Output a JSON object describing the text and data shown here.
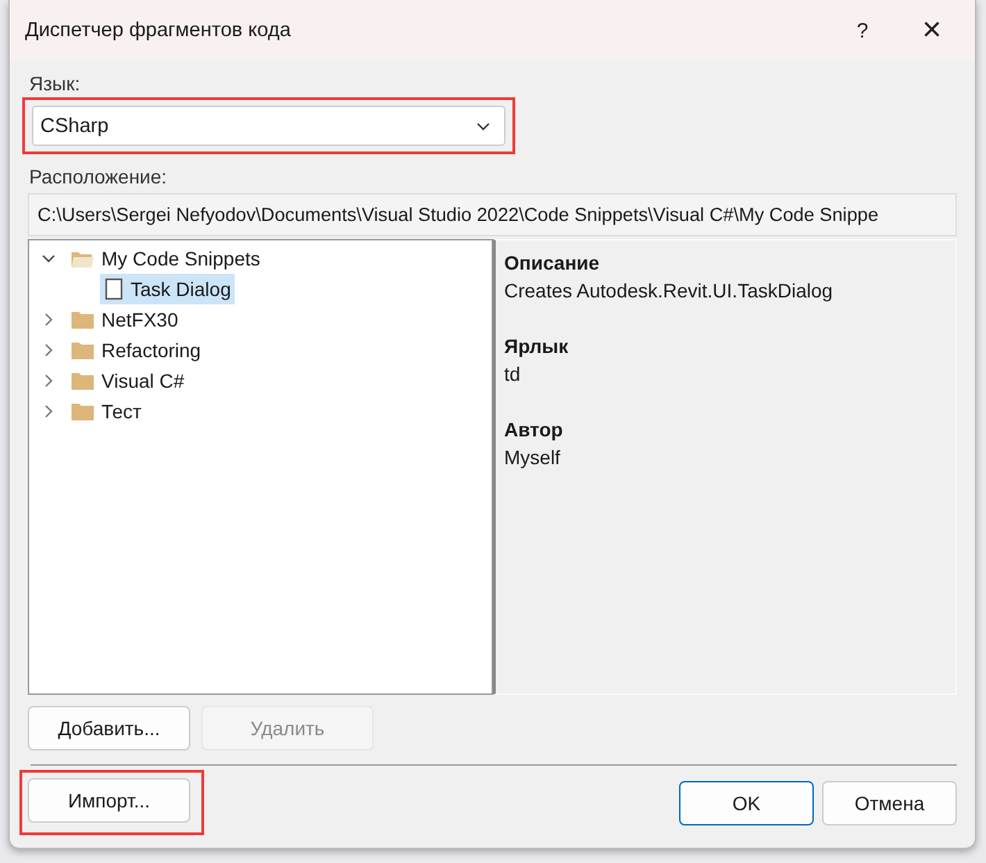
{
  "window": {
    "title": "Диспетчер фрагментов кода",
    "help_button": "?",
    "close_button": "×"
  },
  "language": {
    "label": "Язык:",
    "value": "CSharp",
    "highlighted": true
  },
  "location": {
    "label": "Расположение:",
    "value": "C:\\Users\\Sergei Nefyodov\\Documents\\Visual Studio 2022\\Code Snippets\\Visual C#\\My Code Snippe"
  },
  "tree": [
    {
      "label": "My Code Snippets",
      "kind": "folder",
      "expanded": true,
      "selected": false,
      "children": [
        {
          "label": "Task Dialog",
          "kind": "snippet",
          "selected": true
        }
      ]
    },
    {
      "label": "NetFX30",
      "kind": "folder",
      "expanded": false,
      "selected": false
    },
    {
      "label": "Refactoring",
      "kind": "folder",
      "expanded": false,
      "selected": false
    },
    {
      "label": "Visual C#",
      "kind": "folder",
      "expanded": false,
      "selected": false
    },
    {
      "label": "Тест",
      "kind": "folder",
      "expanded": false,
      "selected": false
    }
  ],
  "details": [
    {
      "heading": "Описание",
      "value": "Creates Autodesk.Revit.UI.TaskDialog"
    },
    {
      "heading": "Ярлык",
      "value": "td"
    },
    {
      "heading": "Автор",
      "value": "Myself"
    }
  ],
  "list_buttons": [
    {
      "label": "Добавить...",
      "disabled": false
    },
    {
      "label": "Удалить",
      "disabled": true
    }
  ],
  "import_button": {
    "label": "Импорт...",
    "highlighted": true
  },
  "dialog_buttons": [
    {
      "label": "OK",
      "kind": "default"
    },
    {
      "label": "Отмена",
      "kind": "normal"
    }
  ]
}
